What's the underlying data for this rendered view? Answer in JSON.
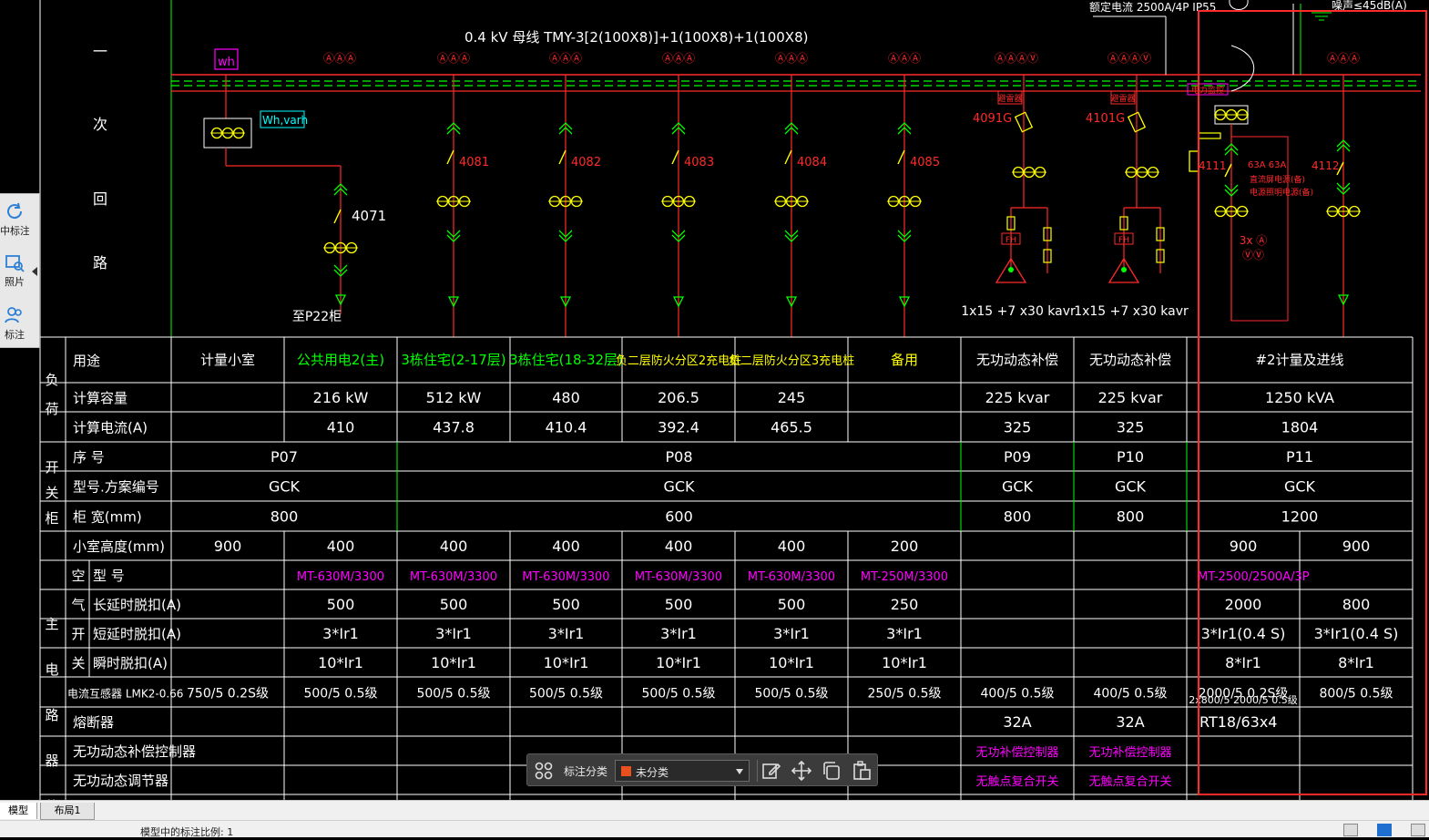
{
  "diagram": {
    "side_label": [
      "一",
      "次",
      "回",
      "路"
    ],
    "busbar_spec": "0.4 kV  母线 TMY-3[2(100X8)]+1(100X8)+1(100X8)",
    "top_right_text_1": "额定电流 2500A/4P IP55",
    "top_right_text_2": "噪声≤45dB(A)",
    "meter_wh": "wh",
    "meter_whvarh": "Wh,varh",
    "ammeter_glyph": "ⒶⒶⒶ",
    "ammeter_var_glyph": "ⒶⒶⒶⓋ",
    "circuits": [
      {
        "id": "4071",
        "dest": "至P22柜"
      },
      {
        "id": "4081"
      },
      {
        "id": "4082"
      },
      {
        "id": "4083"
      },
      {
        "id": "4084"
      },
      {
        "id": "4085"
      },
      {
        "id": "4091G",
        "tag": "避雷器",
        "cable": "1x15 +7 x30 kavr"
      },
      {
        "id": "4101G",
        "tag": "避雷器",
        "cable": "1x15 +7 x30 kavr"
      },
      {
        "id": "4111",
        "tag": "电力监控"
      },
      {
        "id": "4112"
      }
    ],
    "incomer_label_1": "63A 63A",
    "incomer_label_2": "直流屏电源(备)",
    "incomer_label_3": "电源照明电源(备)",
    "incomer_meter": "3x Ⓐ",
    "incomer_meter_v": "ⓋⓋ",
    "fh": "FH"
  },
  "table": {
    "groups": {
      "load": "负荷",
      "switch": "开关柜",
      "main": "主电路器件"
    },
    "sub_groups": {
      "breaker": [
        "空",
        "气",
        "开",
        "关"
      ]
    },
    "rows": {
      "usage": "用途",
      "capacity": "计算容量",
      "current": "计算电流(A)",
      "seq": "序 号",
      "model": "型号.方案编号",
      "width": "柜 宽(mm)",
      "height": "小室高度(mm)",
      "type": "型 号",
      "long": "长延时脱扣(A)",
      "short": "短延时脱扣(A)",
      "inst": "瞬时脱扣(A)",
      "ct": "电流互感器 LMK2-0.66",
      "fuse": "熔断器",
      "ctrl": "无功动态补偿控制器",
      "reg": "无功动态调节器"
    },
    "usage": [
      "计量小室",
      "公共用电2(主)",
      "3栋住宅(2-17层)",
      "3栋住宅(18-32层)",
      "负二层防火分区2充电桩",
      "负二层防火分区3充电桩",
      "备用",
      "无功动态补偿",
      "无功动态补偿",
      "#2计量及进线"
    ],
    "capacity": [
      "",
      "216 kW",
      "512 kW",
      "480",
      "206.5",
      "245",
      "",
      "225 kvar",
      "225 kvar",
      "1250 kVA"
    ],
    "current": [
      "",
      "410",
      "437.8",
      "410.4",
      "392.4",
      "465.5",
      "",
      "325",
      "325",
      "1804"
    ],
    "seq": [
      "P07",
      "P08",
      "P09",
      "P10",
      "P11"
    ],
    "model": [
      "GCK",
      "GCK",
      "GCK",
      "GCK",
      "GCK"
    ],
    "width": [
      "800",
      "600",
      "800",
      "800",
      "1200"
    ],
    "height": [
      "900",
      "400",
      "400",
      "400",
      "400",
      "400",
      "200",
      "",
      "",
      "900",
      "900"
    ],
    "breaker_type": [
      "",
      "MT-630M/3300",
      "MT-630M/3300",
      "MT-630M/3300",
      "MT-630M/3300",
      "MT-630M/3300",
      "MT-250M/3300",
      "",
      "",
      "MT-2500/2500A/3P",
      ""
    ],
    "long_delay": [
      "",
      "500",
      "500",
      "500",
      "500",
      "500",
      "250",
      "",
      "",
      "2000",
      "800"
    ],
    "short_delay": [
      "",
      "3*Ir1",
      "3*Ir1",
      "3*Ir1",
      "3*Ir1",
      "3*Ir1",
      "3*Ir1",
      "",
      "",
      "3*Ir1(0.4 S)",
      "3*Ir1(0.4 S)"
    ],
    "instant": [
      "",
      "10*Ir1",
      "10*Ir1",
      "10*Ir1",
      "10*Ir1",
      "10*Ir1",
      "10*Ir1",
      "",
      "",
      "8*Ir1",
      "8*Ir1"
    ],
    "ct": [
      "750/5 0.2S级",
      "500/5 0.5级",
      "500/5 0.5级",
      "500/5 0.5级",
      "500/5 0.5级",
      "500/5 0.5级",
      "250/5 0.5级",
      "400/5 0.5级",
      "400/5 0.5级",
      "2000/5 0.2S级",
      "800/5 0.5级"
    ],
    "ct_extra": "2x800/5 2000/5 0.5级",
    "fuse": [
      "",
      "",
      "",
      "",
      "",
      "",
      "",
      "32A",
      "32A",
      "RT18/63x4",
      ""
    ],
    "ctrl": [
      "",
      "",
      "",
      "",
      "",
      "",
      "",
      "无功补偿控制器",
      "无功补偿控制器",
      "",
      ""
    ],
    "reg": [
      "",
      "",
      "",
      "",
      "",
      "",
      "",
      "无触点复合开关",
      "无触点复合开关",
      "",
      ""
    ]
  },
  "sidepanel": {
    "items": [
      "中标注",
      "照片",
      "标注"
    ]
  },
  "toolbar": {
    "label": "标注分类",
    "select_value": "未分类"
  },
  "tabs": {
    "model": "模型",
    "layout1": "布局1"
  },
  "status": {
    "text": "模型中的标注比例: 1"
  },
  "colors": {
    "green": "#00ff00",
    "red": "#ff2a2a",
    "yellow": "#ffff00",
    "magenta": "#ff00ff",
    "white": "#ffffff",
    "cyan": "#00ffff"
  }
}
